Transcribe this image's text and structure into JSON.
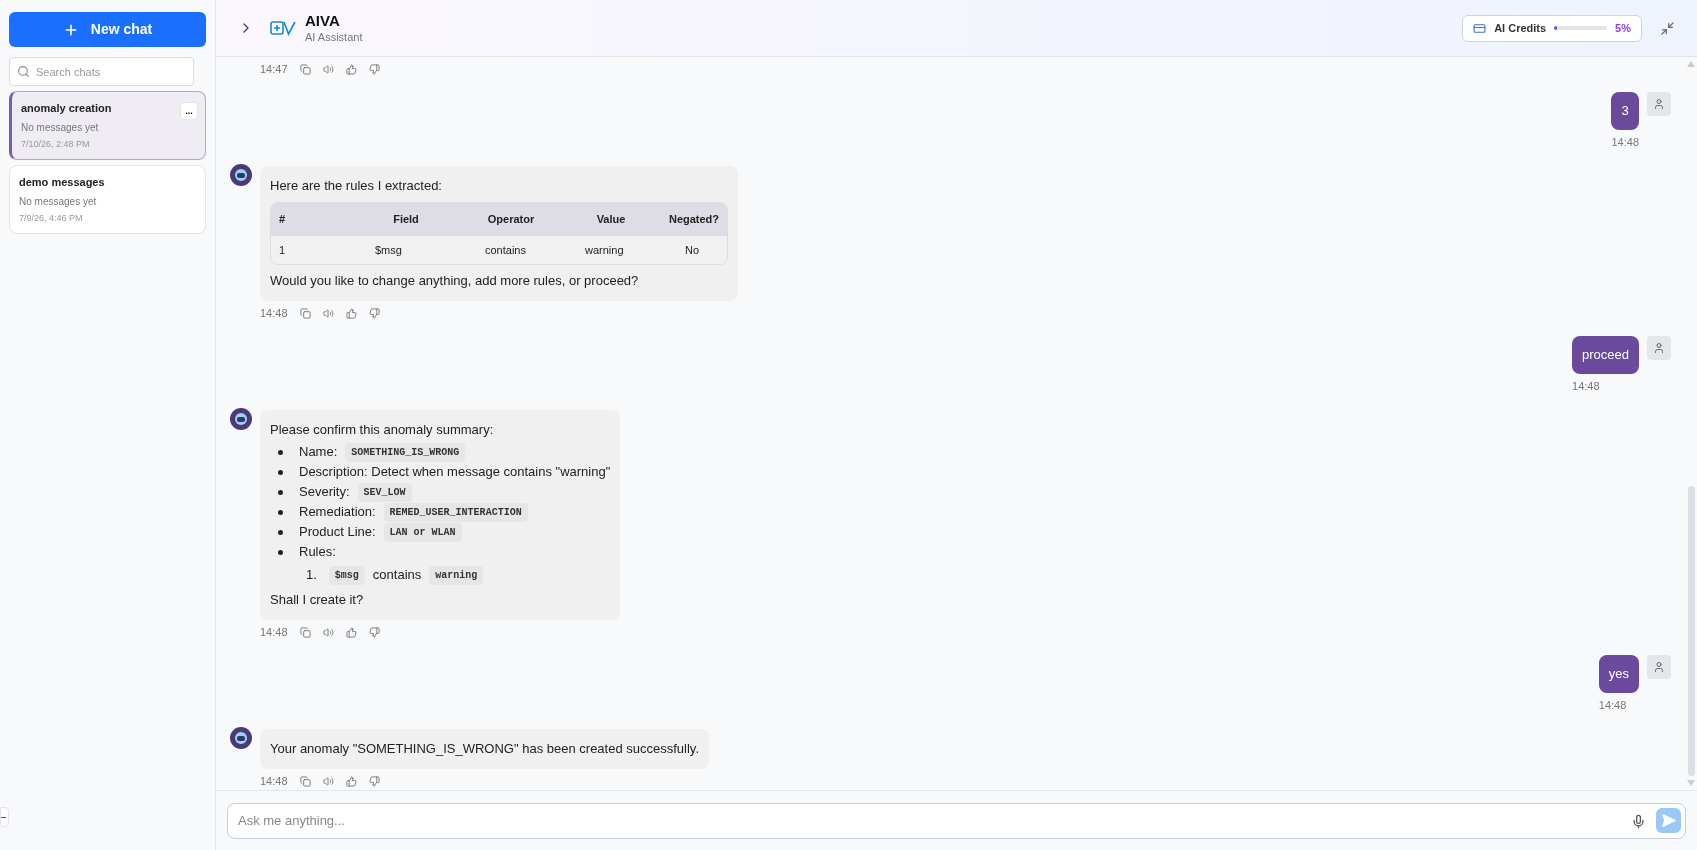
{
  "sidebar": {
    "new_chat_label": "New chat",
    "search": {
      "placeholder": "Search chats"
    },
    "chats": [
      {
        "title": "anomaly creation",
        "preview": "No messages yet",
        "date": "7/10/26, 2:48 PM",
        "selected": true,
        "menu": "..."
      },
      {
        "title": "demo messages",
        "preview": "No messages yet",
        "date": "7/9/26, 4:46 PM",
        "selected": false
      }
    ]
  },
  "header": {
    "title": "AIVA",
    "subtitle": "AI Assistant",
    "credits": {
      "label": "AI Credits",
      "level": 0.05,
      "reading": "5%"
    }
  },
  "messages": [
    {
      "kind": "assistant",
      "time": "14:47"
    },
    {
      "kind": "user",
      "text": "3",
      "time": "14:48"
    },
    {
      "kind": "assistant",
      "time": "14:48",
      "blocks": [
        {
          "kind": "paragraph",
          "text": "Here are the rules I extracted:"
        },
        {
          "kind": "table",
          "columns": [
            "#",
            "Field",
            "Operator",
            "Value",
            "Negated?"
          ],
          "rows": [
            [
              "1",
              "$msg",
              "contains",
              "warning",
              "No"
            ]
          ]
        },
        {
          "kind": "paragraph",
          "text": "Would you like to change anything, add more rules, or proceed?"
        }
      ]
    },
    {
      "kind": "user",
      "text": "proceed",
      "time": "14:48"
    },
    {
      "kind": "assistant",
      "time": "14:48",
      "blocks": [
        {
          "kind": "paragraph",
          "text": "Please confirm this anomaly summary:"
        },
        {
          "kind": "bullets",
          "items": [
            {
              "parts": [
                {
                  "kind": "text",
                  "text": "Name:"
                },
                {
                  "kind": "code",
                  "text": "SOMETHING_IS_WRONG"
                }
              ]
            },
            {
              "parts": [
                {
                  "kind": "text",
                  "text": "Description: Detect when message contains \"warning\""
                }
              ]
            },
            {
              "parts": [
                {
                  "kind": "text",
                  "text": "Severity:"
                },
                {
                  "kind": "code",
                  "text": "SEV_LOW"
                }
              ]
            },
            {
              "parts": [
                {
                  "kind": "text",
                  "text": "Remediation:"
                },
                {
                  "kind": "code",
                  "text": "REMED_USER_INTERACTION"
                }
              ]
            },
            {
              "parts": [
                {
                  "kind": "text",
                  "text": "Product Line:"
                },
                {
                  "kind": "code",
                  "text": "LAN or WLAN"
                }
              ]
            },
            {
              "parts": [
                {
                  "kind": "text",
                  "text": "Rules:"
                }
              ],
              "children": [
                {
                  "marker": "1.",
                  "parts": [
                    {
                      "kind": "code",
                      "text": "$msg"
                    },
                    {
                      "kind": "text",
                      "text": "contains"
                    },
                    {
                      "kind": "code",
                      "text": "warning"
                    }
                  ]
                }
              ]
            }
          ]
        },
        {
          "kind": "paragraph",
          "text": "Shall I create it?"
        }
      ]
    },
    {
      "kind": "user",
      "text": "yes",
      "time": "14:48"
    },
    {
      "kind": "assistant",
      "time": "14:48",
      "blocks": [
        {
          "kind": "paragraph",
          "text": "Your anomaly \"SOMETHING_IS_WRONG\" has been created successfully."
        }
      ]
    }
  ],
  "composer": {
    "placeholder": "Ask me anything..."
  }
}
